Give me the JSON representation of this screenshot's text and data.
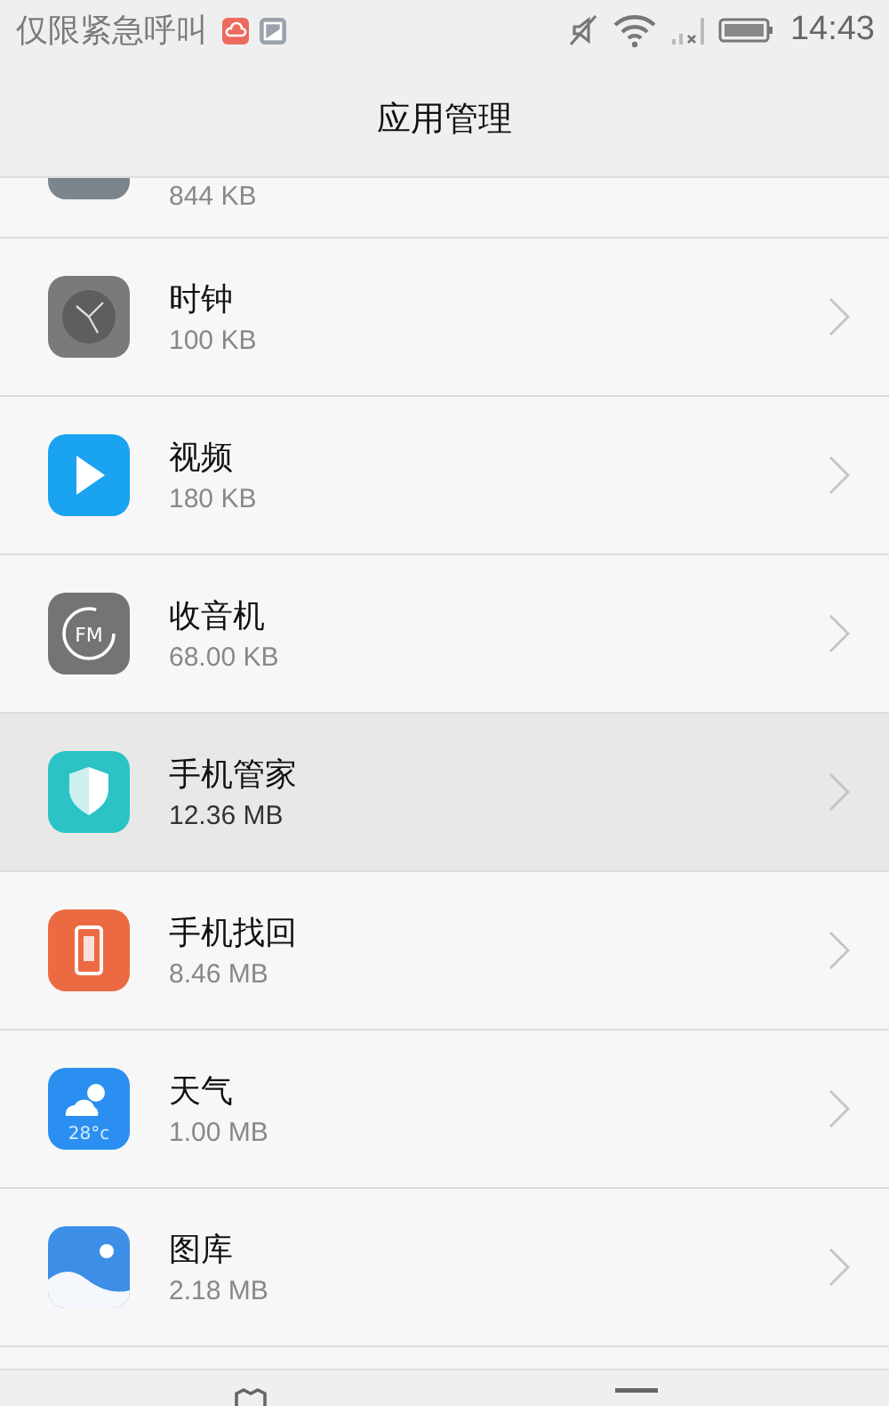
{
  "status_bar": {
    "carrier": "仅限紧急呼叫",
    "time": "14:43"
  },
  "header": {
    "title": "应用管理"
  },
  "apps": [
    {
      "kind": "generic",
      "size": "844 KB",
      "selected": false
    },
    {
      "kind": "clock",
      "name": "时钟",
      "size": "100 KB",
      "selected": false
    },
    {
      "kind": "video",
      "name": "视频",
      "size": "180 KB",
      "selected": false
    },
    {
      "kind": "radio",
      "name": "收音机",
      "size": "68.00 KB",
      "icon_text": "FM",
      "selected": false
    },
    {
      "kind": "shield",
      "name": "手机管家",
      "size": "12.36 MB",
      "selected": true
    },
    {
      "kind": "phone",
      "name": "手机找回",
      "size": "8.46 MB",
      "selected": false
    },
    {
      "kind": "weather",
      "name": "天气",
      "size": "1.00 MB",
      "icon_text": "28°c",
      "selected": false
    },
    {
      "kind": "gallery",
      "name": "图库",
      "size": "2.18 MB",
      "selected": false
    }
  ]
}
